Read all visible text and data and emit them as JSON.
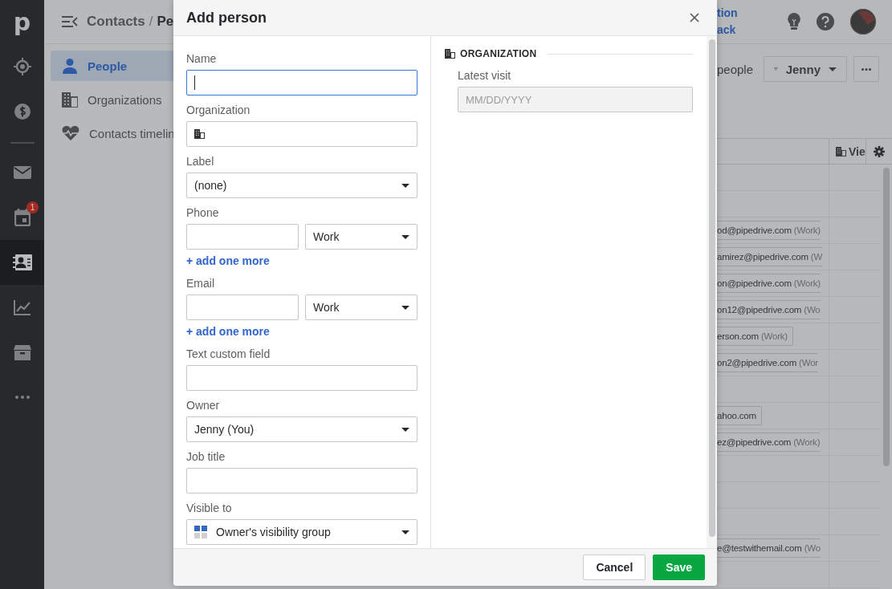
{
  "rail": {
    "logo": "p",
    "items": [
      {
        "selected": false
      },
      {
        "selected": false
      },
      {
        "selected": false
      },
      {
        "selected": false,
        "badge": "1"
      },
      {
        "selected": true
      },
      {
        "selected": false
      },
      {
        "selected": false
      },
      {
        "selected": false
      }
    ]
  },
  "breadcrumb": [
    "Contacts",
    "/",
    "Pe"
  ],
  "sidebar": {
    "items": [
      {
        "label": "People",
        "selected": true
      },
      {
        "label": "Organizations",
        "selected": false
      },
      {
        "label": "Contacts timelin",
        "selected": false
      }
    ]
  },
  "topbar": {
    "links": [
      "tion",
      "ack"
    ]
  },
  "toolbar": {
    "count_text": "people",
    "filter": "Jenny"
  },
  "table": {
    "header": "Vie",
    "rows": [
      {},
      {},
      {
        "email": "od@pipedrive.com",
        "type": "(Work)"
      },
      {
        "email": "amirez@pipedrive.com",
        "type": "(W"
      },
      {
        "email": "on@pipedrive.com",
        "type": "(Work)"
      },
      {
        "email": "on12@pipedrive.com",
        "type": "(Wo"
      },
      {
        "email": "erson.com",
        "type": "(Work)",
        "closed": true
      },
      {
        "email": "on2@pipedrive.com",
        "type": "(Wor"
      },
      {},
      {
        "email": "ahoo.com",
        "closed": true
      },
      {
        "email": "ez@pipedrive.com",
        "type": "(Work)"
      },
      {},
      {},
      {},
      {
        "email": "e@testwithemail.com",
        "type": "(Wo"
      },
      {}
    ]
  },
  "modal": {
    "title": "Add person",
    "fields": [
      {
        "kind": "text",
        "label": "Name",
        "focused": true
      },
      {
        "kind": "org",
        "label": "Organization",
        "focused": false
      },
      {
        "kind": "select",
        "label": "Label",
        "value": "(none)"
      },
      {
        "kind": "multi",
        "label": "Phone",
        "value": "Work",
        "add_link": "+ add one more"
      },
      {
        "kind": "multi",
        "label": "Email",
        "value": "Work",
        "add_link": "+ add one more"
      },
      {
        "kind": "text",
        "label": "Text custom field",
        "focused": false
      },
      {
        "kind": "select",
        "label": "Owner",
        "value": "Jenny (You)"
      },
      {
        "kind": "text",
        "label": "Job title",
        "focused": false
      },
      {
        "kind": "visibility",
        "label": "Visible to",
        "value": "Owner's visibility group"
      }
    ],
    "section": {
      "title": "ORGANIZATION",
      "field_label": "Latest visit",
      "placeholder": "MM/DD/YYYY"
    },
    "buttons": [
      {
        "kind": "secondary",
        "label": "Cancel"
      },
      {
        "kind": "primary",
        "label": "Save"
      }
    ]
  }
}
